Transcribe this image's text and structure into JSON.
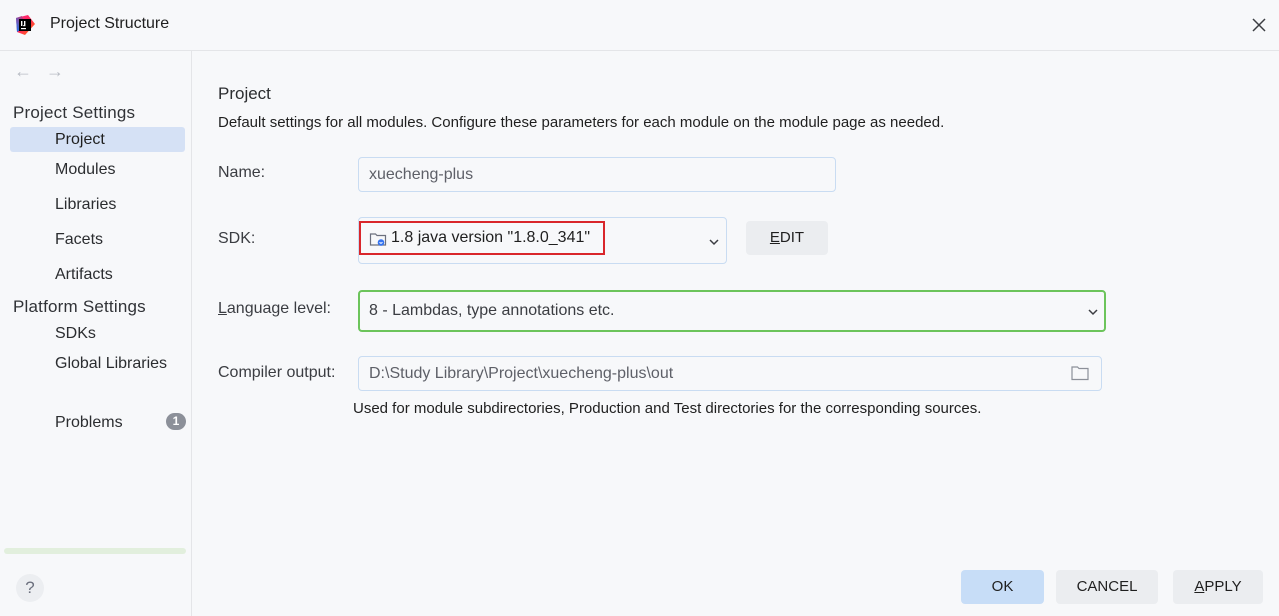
{
  "window": {
    "title": "Project Structure"
  },
  "sidebar": {
    "nav": {
      "back": "←",
      "forward": "→"
    },
    "groups": [
      {
        "header": "Project Settings"
      },
      {
        "header": "Platform Settings"
      }
    ],
    "items": {
      "project": "Project",
      "modules": "Modules",
      "libraries": "Libraries",
      "facets": "Facets",
      "artifacts": "Artifacts",
      "sdks": "SDKs",
      "global_libraries": "Global Libraries",
      "problems": "Problems"
    },
    "problems_count": "1",
    "help": "?"
  },
  "main": {
    "title": "Project",
    "description": "Default settings for all modules. Configure these parameters for each module on the module page as needed.",
    "name": {
      "label": "Name:",
      "value": "xuecheng-plus"
    },
    "sdk": {
      "label": "SDK:",
      "value": "1.8 java version \"1.8.0_341\"",
      "edit_prefix": "E",
      "edit_rest": "DIT"
    },
    "language_level": {
      "label_prefix": "L",
      "label_rest": "anguage level:",
      "value": "8 - Lambdas, type annotations etc."
    },
    "compiler_output": {
      "label": "Compiler output:",
      "value": "D:\\Study Library\\Project\\xuecheng-plus\\out",
      "hint": "Used for module subdirectories, Production and Test directories for the corresponding sources."
    }
  },
  "footer": {
    "ok": "OK",
    "cancel": "CANCEL",
    "apply_prefix": "A",
    "apply_rest": "PPLY"
  },
  "colors": {
    "selection": "#d5e1f5",
    "highlight_border": "#d9262b",
    "language_border": "#6cc45b",
    "ok_button": "#c7ddf7"
  }
}
